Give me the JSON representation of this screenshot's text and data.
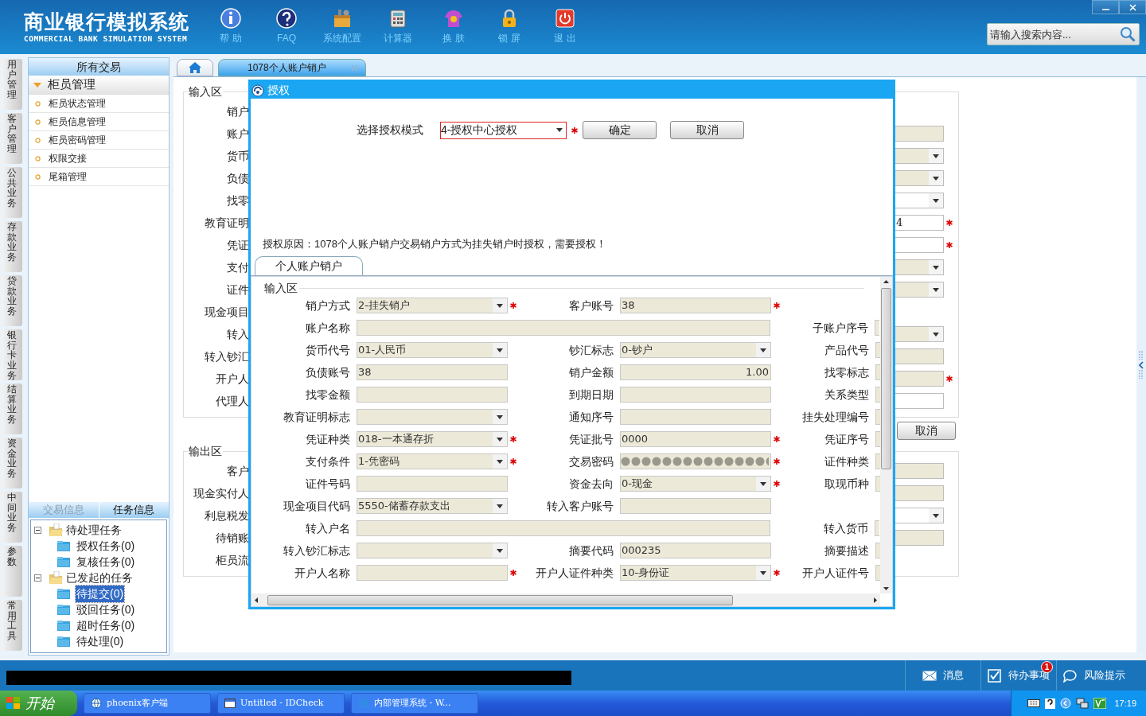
{
  "app": {
    "title": "商业银行模拟系统",
    "subtitle": "COMMERCIAL BANK SIMULATION SYSTEM"
  },
  "toolbar": [
    {
      "kind": "info",
      "label": "帮 助"
    },
    {
      "kind": "faq",
      "label": "FAQ"
    },
    {
      "kind": "config",
      "label": "系统配置"
    },
    {
      "kind": "calculator",
      "label": "计算器"
    },
    {
      "kind": "skin",
      "label": "换 肤"
    },
    {
      "kind": "lock",
      "label": "锁 屏"
    },
    {
      "kind": "exit",
      "label": "退 出"
    }
  ],
  "window_controls": [
    {
      "kind": "minimize"
    },
    {
      "kind": "close"
    }
  ],
  "search": {
    "placeholder": "请输入搜索内容..."
  },
  "side_tabs": [
    "用户管理",
    "客户管理",
    "公共业务",
    "存款业务",
    "贷款业务",
    "银行卡业务",
    "结算业务",
    "资金业务",
    "中间业务",
    "参数",
    "常用工具"
  ],
  "nav": {
    "header": "所有交易",
    "group": {
      "label": "柜员管理",
      "expanded": true,
      "items": [
        "柜员状态管理",
        "柜员信息管理",
        "柜员密码管理",
        "权限交接",
        "尾箱管理"
      ]
    }
  },
  "info_tabs": [
    {
      "label": "交易信息",
      "selected": false
    },
    {
      "label": "任务信息",
      "selected": true
    }
  ],
  "task_tree": [
    {
      "label": "待处理任务",
      "expanded": true,
      "selected": false,
      "children": [
        {
          "label": "授权任务(0)",
          "selected": false
        },
        {
          "label": "复核任务(0)",
          "selected": false
        }
      ]
    },
    {
      "label": "已发起的任务",
      "expanded": true,
      "selected": false,
      "children": [
        {
          "label": "待提交(0)",
          "selected": true
        },
        {
          "label": "驳回任务(0)",
          "selected": false
        },
        {
          "label": "超时任务(0)",
          "selected": false
        },
        {
          "label": "待处理(0)",
          "selected": false
        }
      ]
    }
  ],
  "doc_tabs": [
    {
      "kind": "home",
      "selected": false
    },
    {
      "kind": "page",
      "label": "1078个人账户销户",
      "selected": true
    }
  ],
  "form": {
    "input_section": {
      "title": "输入区",
      "rows": [
        {
          "label": "销户"
        },
        {
          "label": "账户",
          "field": {
            "kind": "text",
            "readonly": true,
            "required": false
          }
        },
        {
          "label": "货币",
          "field": {
            "kind": "select",
            "readonly": true,
            "required": false
          }
        },
        {
          "label": "负债",
          "field": {
            "kind": "select",
            "readonly": true,
            "required": false
          }
        },
        {
          "label": "找零",
          "field": {
            "kind": "select",
            "readonly": false,
            "required": false
          }
        },
        {
          "label": "教育证明",
          "field": {
            "kind": "text",
            "readonly": false,
            "required": true,
            "value": "4"
          }
        },
        {
          "label": "凭证",
          "field": {
            "kind": "text",
            "readonly": false,
            "required": true
          }
        },
        {
          "label": "支付",
          "field": {
            "kind": "select",
            "readonly": true,
            "required": false
          }
        },
        {
          "label": "证件",
          "field": {
            "kind": "select",
            "readonly": true,
            "required": false
          }
        },
        {
          "label": "现金项目"
        },
        {
          "label": "转入",
          "field": {
            "kind": "select",
            "readonly": true,
            "required": false
          }
        },
        {
          "label": "转入钞汇",
          "field": {
            "kind": "text",
            "readonly": true,
            "required": false
          }
        },
        {
          "label": "开户人",
          "field": {
            "kind": "text",
            "readonly": true,
            "required": true
          }
        },
        {
          "label": "代理人",
          "field": {
            "kind": "text",
            "readonly": false,
            "required": false
          }
        }
      ]
    },
    "cancel_button": "取消",
    "output_section": {
      "title": "输出区",
      "rows": [
        {
          "label": "客户",
          "field": {
            "kind": "text",
            "readonly": true,
            "required": false
          }
        },
        {
          "label": "现金实付人",
          "field": {
            "kind": "text",
            "readonly": true,
            "required": false
          }
        },
        {
          "label": "利息税发",
          "field": {
            "kind": "select",
            "readonly": false,
            "required": false
          }
        },
        {
          "label": "待销账",
          "field": {
            "kind": "text",
            "readonly": true,
            "required": false
          }
        },
        {
          "label": "柜员流"
        }
      ]
    }
  },
  "dialog": {
    "title": "授权",
    "mode_label": "选择授权模式",
    "mode_select": {
      "value": "4-授权中心授权",
      "required": true
    },
    "buttons": [
      "确定",
      "取消"
    ],
    "reason": "授权原因：1078个人账户销户交易销户方式为挂失销户时授权，需要授权！",
    "tab": "个人账户销户",
    "section_title": "输入区",
    "rows": [
      [
        {
          "label": "销户方式",
          "field": {
            "kind": "select",
            "value": "2-挂失销户",
            "required": true
          }
        },
        {
          "label": "客户账号",
          "field": {
            "kind": "text",
            "value": "38",
            "required": true
          }
        }
      ],
      [
        {
          "label": "账户名称",
          "field": {
            "kind": "wide",
            "required": false
          }
        },
        {
          "label": "子账户序号",
          "field": {
            "kind": "text"
          }
        }
      ],
      [
        {
          "label": "货币代号",
          "field": {
            "kind": "select",
            "value": "01-人民币",
            "required": false
          }
        },
        {
          "label": "钞汇标志",
          "field": {
            "kind": "select",
            "value": "0-钞户",
            "required": false
          }
        },
        {
          "label": "产品代号",
          "field": {
            "kind": "text"
          }
        }
      ],
      [
        {
          "label": "负债账号",
          "field": {
            "kind": "text",
            "value": "38",
            "required": false
          }
        },
        {
          "label": "销户金额",
          "field": {
            "kind": "amount",
            "value": "1.00",
            "required": false
          }
        },
        {
          "label": "找零标志",
          "field": {
            "kind": "text"
          }
        }
      ],
      [
        {
          "label": "找零金额",
          "field": {
            "kind": "text",
            "required": false
          }
        },
        {
          "label": "到期日期",
          "field": {
            "kind": "text",
            "required": false
          }
        },
        {
          "label": "关系类型",
          "field": {
            "kind": "text"
          }
        }
      ],
      [
        {
          "label": "教育证明标志",
          "field": {
            "kind": "select",
            "required": false
          }
        },
        {
          "label": "通知序号",
          "field": {
            "kind": "text",
            "required": false
          }
        },
        {
          "label": "挂失处理编号",
          "field": {
            "kind": "text"
          }
        }
      ],
      [
        {
          "label": "凭证种类",
          "field": {
            "kind": "select",
            "value": "018-一本通存折",
            "required": true
          }
        },
        {
          "label": "凭证批号",
          "field": {
            "kind": "text",
            "value": "0000",
            "required": true
          }
        },
        {
          "label": "凭证序号",
          "field": {
            "kind": "text"
          }
        }
      ],
      [
        {
          "label": "支付条件",
          "field": {
            "kind": "select",
            "value": "1-凭密码",
            "required": true
          }
        },
        {
          "label": "交易密码",
          "field": {
            "kind": "password",
            "required": true
          }
        },
        {
          "label": "证件种类",
          "field": {
            "kind": "text"
          }
        }
      ],
      [
        {
          "label": "证件号码",
          "field": {
            "kind": "text",
            "required": false
          }
        },
        {
          "label": "资金去向",
          "field": {
            "kind": "select",
            "value": "0-现金",
            "required": true
          }
        },
        {
          "label": "取现币种",
          "field": {
            "kind": "text"
          }
        }
      ],
      [
        {
          "label": "现金项目代码",
          "field": {
            "kind": "select",
            "value": "5550-储蓄存款支出",
            "required": false
          }
        },
        {
          "label": "转入客户账号",
          "field": {
            "kind": "text",
            "required": false
          }
        }
      ],
      [
        {
          "label": "转入户名",
          "field": {
            "kind": "wide",
            "required": false
          }
        },
        {
          "label": "转入货币",
          "field": {
            "kind": "text"
          }
        }
      ],
      [
        {
          "label": "转入钞汇标志",
          "field": {
            "kind": "select",
            "required": false
          }
        },
        {
          "label": "摘要代码",
          "field": {
            "kind": "text",
            "value": "000235",
            "required": false
          }
        },
        {
          "label": "摘要描述",
          "field": {
            "kind": "text"
          }
        }
      ],
      [
        {
          "label": "开户人名称",
          "field": {
            "kind": "text",
            "required": true
          }
        },
        {
          "label": "开户人证件种类",
          "field": {
            "kind": "select",
            "value": "10-身份证",
            "required": true
          }
        },
        {
          "label": "开户人证件号",
          "field": {
            "kind": "text"
          }
        }
      ]
    ]
  },
  "status_bar": {
    "items": [
      {
        "kind": "message",
        "label": "消息"
      },
      {
        "kind": "todo",
        "label": "待办事项",
        "badge": "1"
      },
      {
        "kind": "risk",
        "label": "风险提示"
      }
    ]
  },
  "taskbar": {
    "start": "开始",
    "tasks": [
      {
        "kind": "app",
        "label": "phoenix客户端"
      },
      {
        "kind": "window",
        "label": "Untitled - IDCheck"
      },
      {
        "kind": "browser",
        "label": "内部管理系统 - W..."
      }
    ],
    "clock": "17:19"
  }
}
